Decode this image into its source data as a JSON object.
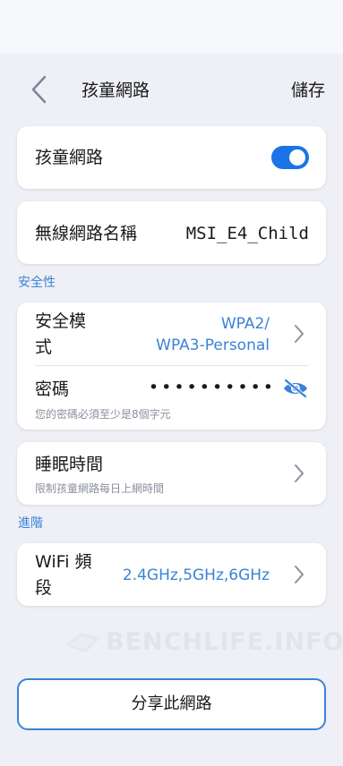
{
  "header": {
    "title": "孩童網路",
    "save_label": "儲存"
  },
  "child_network": {
    "label": "孩童網路",
    "enabled": true
  },
  "network_name": {
    "label": "無線網路名稱",
    "value": "MSI_E4_Child"
  },
  "security": {
    "section_label": "安全性",
    "mode_label_line1": "安全模",
    "mode_label_line2": "式",
    "mode_value_line1": "WPA2/",
    "mode_value_line2": "WPA3-Personal",
    "password_label": "密碼",
    "password_value": "••••••••••",
    "password_hint": "您的密碼必須至少是8個字元"
  },
  "sleep": {
    "label": "睡眠時間",
    "hint": "限制孩童網路每日上網時間"
  },
  "advanced": {
    "section_label": "進階",
    "band_label_line1": "WiFi 頻",
    "band_label_line2": "段",
    "band_value": "2.4GHz,5GHz,6GHz"
  },
  "watermark": {
    "text": "BENCHLIFE.INFO"
  },
  "share_button": {
    "label": "分享此網路"
  },
  "colors": {
    "accent": "#3b82d6",
    "toggle_on": "#1a73e8",
    "background": "#eef0f6"
  }
}
